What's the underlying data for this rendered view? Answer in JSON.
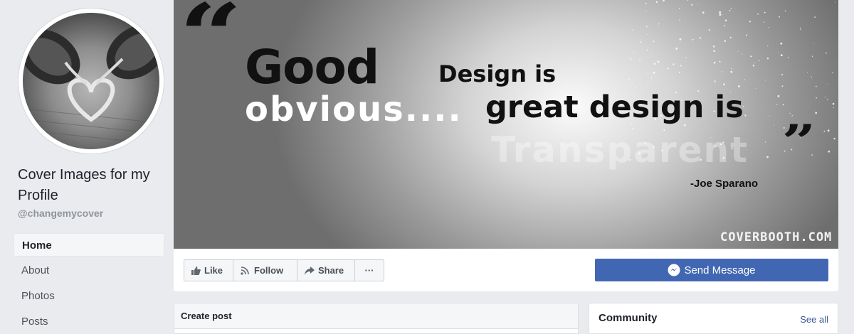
{
  "sidebar": {
    "page_name": "Cover Images for my Profile",
    "handle": "@changemycover",
    "nav": [
      {
        "label": "Home",
        "active": true
      },
      {
        "label": "About",
        "active": false
      },
      {
        "label": "Photos",
        "active": false
      },
      {
        "label": "Posts",
        "active": false
      }
    ]
  },
  "cover": {
    "line1_big": "Good",
    "line1_small": "Design is",
    "line2_white": "obvious....",
    "line2_dark": "great design is",
    "line3_faded": "Transparent",
    "author": "-Joe Sparano",
    "watermark": "COVERBOOTH.COM"
  },
  "actions": {
    "like": "Like",
    "follow": "Follow",
    "share": "Share",
    "more": "···",
    "send_message": "Send Message"
  },
  "create_post": {
    "title": "Create post"
  },
  "community": {
    "title": "Community",
    "see_all": "See all"
  },
  "colors": {
    "brand_blue": "#4267b2",
    "link": "#385898",
    "background": "#e9ebee"
  }
}
